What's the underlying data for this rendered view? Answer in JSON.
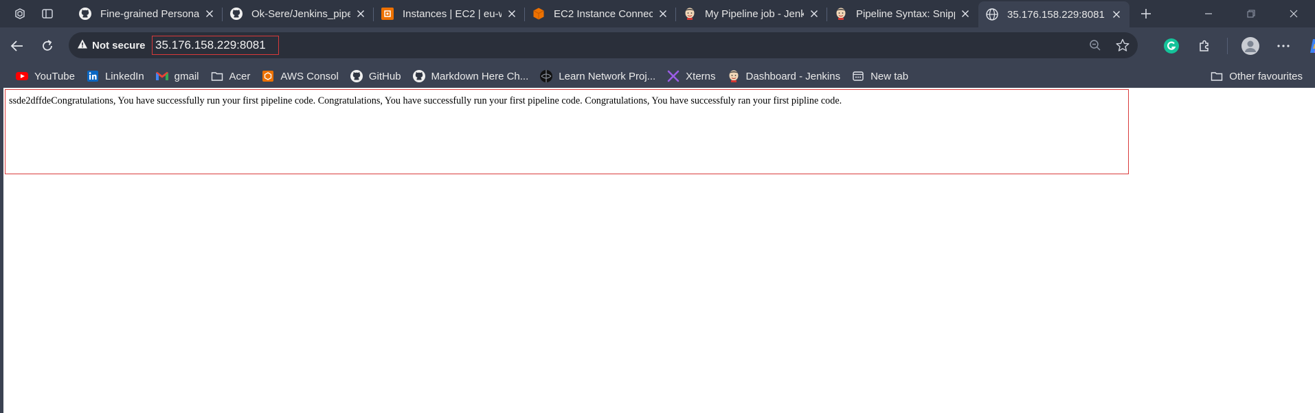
{
  "tabs": [
    {
      "title": "Fine-grained Personal",
      "icon": "github-icon"
    },
    {
      "title": "Ok-Sere/Jenkins_pipe",
      "icon": "github-icon"
    },
    {
      "title": "Instances | EC2 | eu-w",
      "icon": "aws-ec2-icon"
    },
    {
      "title": "EC2 Instance Connect",
      "icon": "aws-cube-icon"
    },
    {
      "title": "My Pipeline job - Jenk",
      "icon": "jenkins-icon"
    },
    {
      "title": "Pipeline Syntax: Snipp",
      "icon": "jenkins-icon"
    },
    {
      "title": "35.176.158.229:8081",
      "icon": "globe-icon",
      "active": true
    }
  ],
  "address_bar": {
    "security_label": "Not secure",
    "url": "35.176.158.229:8081"
  },
  "bookmarks": [
    {
      "label": "YouTube",
      "icon": "youtube-icon"
    },
    {
      "label": "LinkedIn",
      "icon": "linkedin-icon"
    },
    {
      "label": "gmail",
      "icon": "gmail-icon"
    },
    {
      "label": "Acer",
      "icon": "folder-icon"
    },
    {
      "label": "AWS Consol",
      "icon": "aws-icon"
    },
    {
      "label": "GitHub",
      "icon": "github-icon"
    },
    {
      "label": "Markdown Here Ch...",
      "icon": "github-icon"
    },
    {
      "label": "Learn Network Proj...",
      "icon": "network-icon"
    },
    {
      "label": "Xterns",
      "icon": "xterns-icon"
    },
    {
      "label": "Dashboard - Jenkins",
      "icon": "jenkins-icon"
    },
    {
      "label": "New tab",
      "icon": "newtab-icon"
    }
  ],
  "other_favourites": "Other favourites",
  "page": {
    "text": "ssde2dffdeCongratulations, You have successfully run your first pipeline code. Congratulations, You have successfully run your first pipeline code. Congratulations, You have successfuly ran your first pipline code."
  },
  "colors": {
    "highlight": "#d93a3a",
    "tabstrip": "#2f3542",
    "toolbar": "#3b4252"
  }
}
